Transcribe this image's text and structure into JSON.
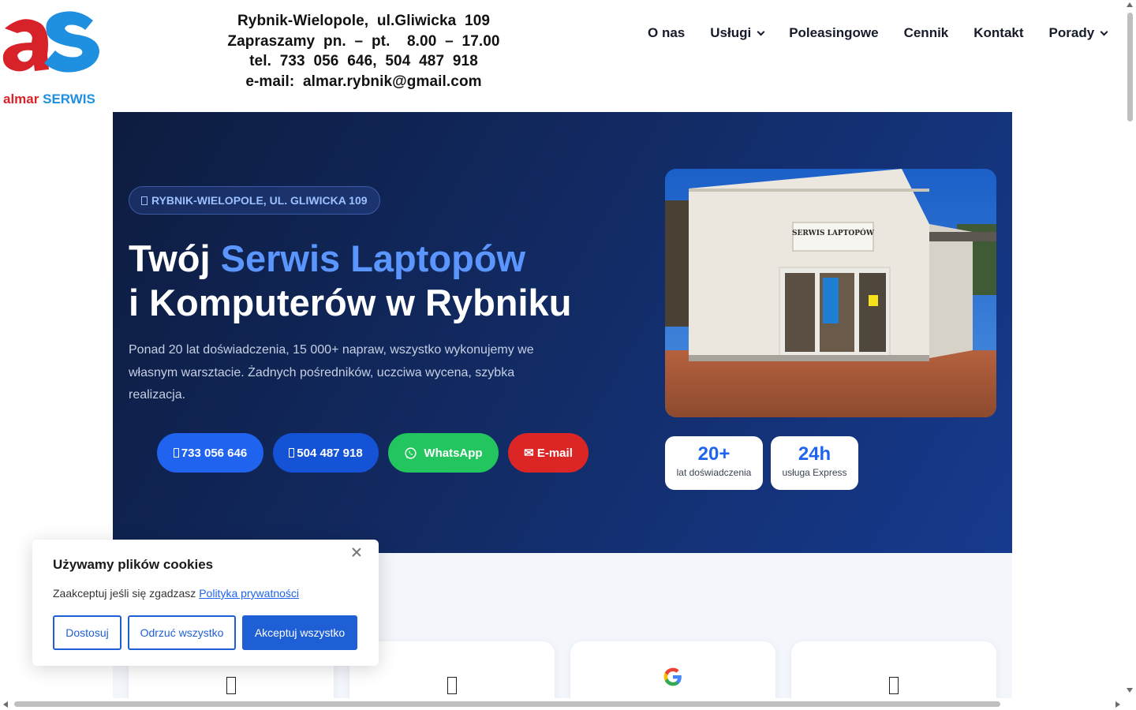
{
  "header": {
    "logo_brand": "almar",
    "logo_suffix": "SERWIS",
    "contact_lines": [
      "Rybnik-Wielopole,  ul.Gliwicka  109",
      "Zapraszamy  pn.  –  pt.    8.00  –  17.00",
      "tel.  733  056  646,  504  487  918",
      "e-mail:  almar.rybnik@gmail.com"
    ]
  },
  "nav": {
    "items": [
      {
        "label": "O nas",
        "has_dropdown": false
      },
      {
        "label": "Usługi",
        "has_dropdown": true
      },
      {
        "label": "Poleasingowe",
        "has_dropdown": false
      },
      {
        "label": "Cennik",
        "has_dropdown": false
      },
      {
        "label": "Kontakt",
        "has_dropdown": false
      },
      {
        "label": "Porady",
        "has_dropdown": true
      }
    ]
  },
  "hero": {
    "location_badge": "RYBNIK-WIELOPOLE, UL. GLIWICKA 109",
    "title_part1": "Twój ",
    "title_accent": "Serwis Laptopów",
    "title_line2": "i Komputerów w Rybniku",
    "description": "Ponad 20 lat doświadczenia, 15 000+ napraw, wszystko wykonujemy we własnym warsztacie. Żadnych pośredników, uczciwa wycena, szybka realizacja.",
    "buttons": {
      "phone1": "733 056 646",
      "phone2": "504 487 918",
      "whatsapp": "WhatsApp",
      "email": "✉ E-mail"
    },
    "photo_sign": "SERWIS LAPTOPÓW",
    "stats": [
      {
        "value": "20+",
        "label": "lat doświadczenia"
      },
      {
        "value": "24h",
        "label": "usługa Express"
      }
    ]
  },
  "cookie": {
    "title": "Używamy plików cookies",
    "text": "Zaakceptuj jeśli się zgadzasz ",
    "link": "Polityka prywatności",
    "customize": "Dostosuj",
    "reject": "Odrzuć wszystko",
    "accept": "Akceptuj wszystko"
  },
  "colors": {
    "accent_blue": "#1f63ee",
    "hero_title_accent": "#5b96ff",
    "whatsapp_green": "#22c55e",
    "email_red": "#dc2626",
    "logo_red": "#d8222a",
    "logo_blue": "#1f8fe0"
  },
  "icons": {
    "badge": "map-pin-icon",
    "phone": "phone-icon",
    "whatsapp": "whatsapp-icon",
    "close": "close-icon",
    "google": "google-icon"
  }
}
